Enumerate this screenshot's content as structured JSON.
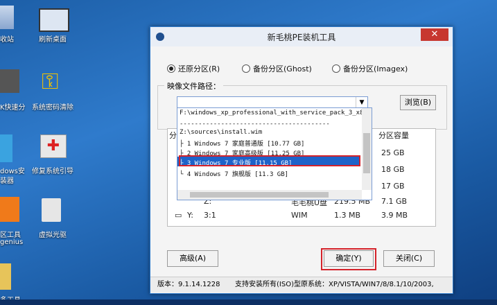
{
  "desktop": {
    "icons": [
      {
        "label": "收站",
        "icon": "recycle-bin-icon"
      },
      {
        "label": "刷新桌面",
        "icon": "monitor-icon"
      },
      {
        "label": "K快速分",
        "icon": "partition-tool-icon"
      },
      {
        "label": "系统密码清除",
        "icon": "key-icon"
      },
      {
        "label": "dows安",
        "icon": "windows-installer-icon"
      },
      {
        "label": "装器",
        "icon": ""
      },
      {
        "label": "修复系统引导",
        "icon": "first-aid-kit-icon"
      },
      {
        "label": "区工具",
        "icon": "disk-tool-icon"
      },
      {
        "label": "genius",
        "icon": ""
      },
      {
        "label": "虚拟光驱",
        "icon": "virtual-cd-icon"
      },
      {
        "label": "多工具",
        "icon": "folder-icon"
      }
    ]
  },
  "window": {
    "title": "新毛桃PE装机工具",
    "close": "✕",
    "radios": [
      {
        "label": "还原分区(R)",
        "checked": true
      },
      {
        "label": "备份分区(Ghost)",
        "checked": false
      },
      {
        "label": "备份分区(Imagex)",
        "checked": false
      }
    ],
    "image_path_label": "映像文件路径：",
    "combo_value": "",
    "browse_label": "浏览(B)",
    "dropdown": [
      "F:\\windows_xp_professional_with_service_pack_3_x8",
      "----------------------------------------",
      "Z:\\sources\\install.wim",
      "├ 1 Windows 7 家庭普通版 [10.77 GB]",
      "├ 2 Windows 7 家庭高级版 [11.25 GB]",
      "├ 3 Windows 7 专业版 [11.15 GB]",
      "└ 4 Windows 7 旗舰版 [11.3 GB]"
    ],
    "table": {
      "col_partial": "分",
      "col_capacity": "分区容量",
      "capacities": [
        "25 GB",
        "18 GB",
        "17 GB",
        "7.1 GB",
        "3.9 MB"
      ],
      "row_partial": [
        "Z:",
        "",
        "毛毛桃U盘",
        "219.5 MB"
      ],
      "last_row": {
        "drive": "Y:",
        "num": "3:1",
        "type": "WIM",
        "size": "1.3 MB",
        "cap": "3.9 MB"
      }
    },
    "advanced_label": "高级(A)",
    "ok_label": "确定(Y)",
    "close_btn_label": "关闭(C)",
    "status_version": "版本：9.1.14.1228",
    "status_text": "支持安装所有(ISO)型原系统：XP/VISTA/WIN7/8/8.1/10/2003,"
  }
}
